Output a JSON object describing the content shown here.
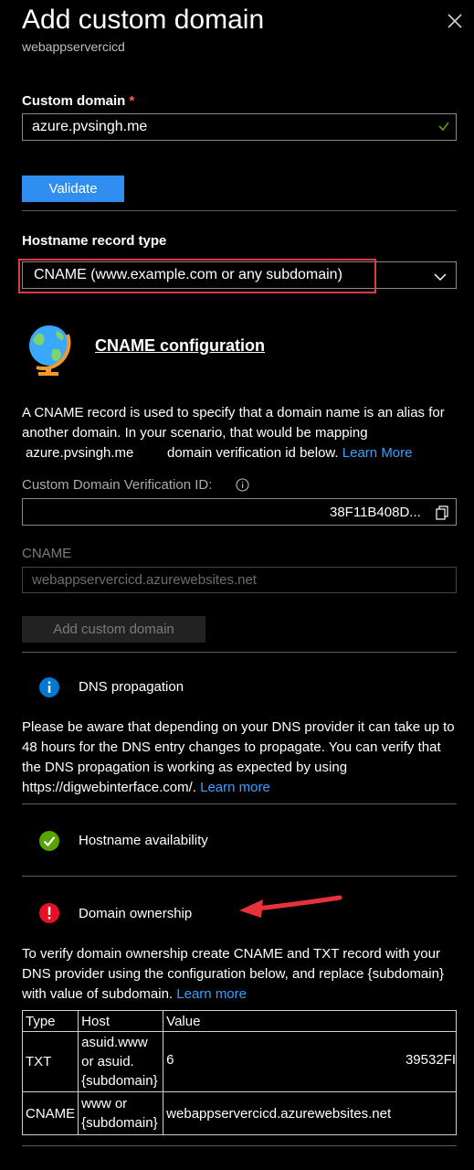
{
  "header": {
    "title": "Add custom domain",
    "subtitle": "webappservercicd",
    "close_icon": "close-icon"
  },
  "custom_domain": {
    "label": "Custom domain",
    "required_mark": "*",
    "value": "azure.pvsingh.me",
    "status_icon": "checkmark-icon",
    "validate_label": "Validate"
  },
  "hostname_record": {
    "label": "Hostname record type",
    "selected": "CNAME (www.example.com or any subdomain)",
    "highlight_color": "#e0383f"
  },
  "cname_config": {
    "icon": "globe-icon",
    "heading": "CNAME configuration",
    "para_part1": "A CNAME record is used to specify that a domain name is an alias for another domain. In your scenario, that would be mapping",
    "para_domain": "azure.pvsingh.me",
    "para_part2": "domain verification id below.",
    "learn_more": "Learn More"
  },
  "verification": {
    "label": "Custom Domain Verification ID:",
    "info_icon": "info-icon",
    "value_suffix": "38F11B408D...",
    "copy_icon": "copy-icon"
  },
  "cname_field": {
    "label": "CNAME",
    "value": "webappservercicd.azurewebsites.net"
  },
  "add_button": {
    "label": "Add custom domain"
  },
  "dns_propagation": {
    "icon": "info-circle-icon",
    "title": "DNS propagation",
    "text": "Please be aware that depending on your DNS provider it can take up to 48 hours for the DNS entry changes to propagate. You can verify that the DNS propagation is working as expected by using https://digwebinterface.com/.",
    "learn_more": "Learn more"
  },
  "hostname_availability": {
    "icon": "check-circle-icon",
    "title": "Hostname availability"
  },
  "domain_ownership": {
    "icon": "error-circle-icon",
    "title": "Domain ownership",
    "arrow_icon": "red-arrow-icon",
    "text": "To verify domain ownership create CNAME and TXT record with your DNS provider using the configuration below, and replace {subdomain} with value of subdomain.",
    "learn_more": "Learn more"
  },
  "dns_table": {
    "headers": [
      "Type",
      "Host",
      "Value"
    ],
    "rows": [
      {
        "type": "TXT",
        "host": "asuid.www or asuid.{subdomain}",
        "value_prefix": "6",
        "value_suffix": "39532FI"
      },
      {
        "type": "CNAME",
        "host": "www or {subdomain}",
        "value": "webappservercicd.azurewebsites.net"
      }
    ]
  },
  "colors": {
    "accent": "#2f8ef0",
    "link": "#3aa0ff",
    "success": "#57a300",
    "error": "#e81123",
    "info": "#0078d4"
  }
}
